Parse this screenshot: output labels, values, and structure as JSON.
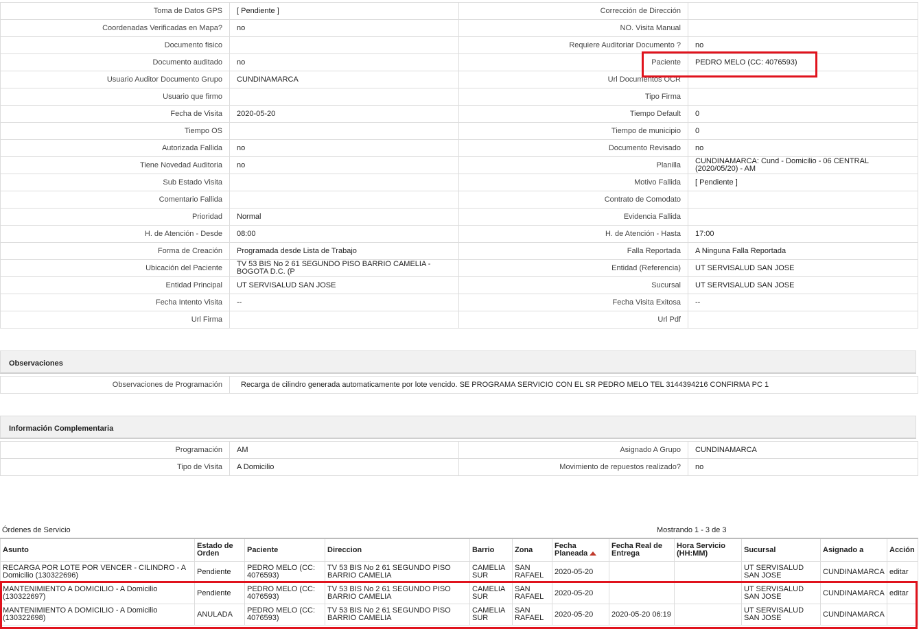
{
  "details": [
    [
      "Toma de Datos GPS",
      "[ Pendiente ]",
      "Corrección de Dirección",
      ""
    ],
    [
      "Coordenadas Verificadas en Mapa?",
      " no",
      "NO. Visita Manual",
      ""
    ],
    [
      "Documento fisico",
      "",
      "Requiere Auditoriar Documento ?",
      " no"
    ],
    [
      "Documento auditado",
      " no",
      "Paciente",
      "PEDRO MELO (CC: 4076593)"
    ],
    [
      "Usuario Auditor Documento Grupo",
      "CUNDINAMARCA",
      "Url Documentos OCR",
      ""
    ],
    [
      "Usuario que firmo",
      "",
      "Tipo Firma",
      ""
    ],
    [
      "Fecha de Visita",
      " 2020-05-20",
      "Tiempo Default",
      "0"
    ],
    [
      "Tiempo OS",
      "",
      "Tiempo de municipio",
      "0"
    ],
    [
      "Autorizada Fallida",
      " no",
      "Documento Revisado",
      " no"
    ],
    [
      "Tiene Novedad Auditoria",
      " no",
      "Planilla",
      "CUNDINAMARCA: Cund - Domicilio - 06 CENTRAL (2020/05/20) - AM"
    ],
    [
      "Sub Estado Visita",
      "",
      "Motivo Fallida",
      "[ Pendiente ]"
    ],
    [
      "Comentario Fallida",
      "",
      "Contrato de Comodato",
      ""
    ],
    [
      "Prioridad",
      "Normal",
      "Evidencia Fallida",
      ""
    ],
    [
      "H. de Atención - Desde",
      "08:00",
      "H. de Atención - Hasta",
      "17:00"
    ],
    [
      "Forma de Creación",
      "Programada desde Lista de Trabajo",
      "Falla Reportada",
      "A Ninguna Falla Reportada"
    ],
    [
      "Ubicación del Paciente",
      "TV 53 BIS No 2 61 SEGUNDO PISO BARRIO CAMELIA - BOGOTA D.C. (P",
      "Entidad (Referencia)",
      "UT SERVISALUD SAN JOSE"
    ],
    [
      "Entidad Principal",
      "UT SERVISALUD SAN JOSE",
      "Sucursal",
      "UT SERVISALUD SAN JOSE"
    ],
    [
      "Fecha Intento Visita",
      " --",
      "Fecha Visita Exitosa",
      " --"
    ],
    [
      "Url Firma",
      "",
      "Url Pdf",
      ""
    ]
  ],
  "observaciones": {
    "title": "Observaciones",
    "label": "Observaciones de Programación",
    "value": "Recarga de cilindro generada automaticamente por lote vencido. SE PROGRAMA SERVICIO CON EL SR PEDRO MELO TEL 3144394216 CONFIRMA PC 1"
  },
  "complementaria": {
    "title": "Información Complementaria",
    "rows": [
      [
        "Programación",
        "AM",
        "Asignado A Grupo",
        "CUNDINAMARCA"
      ],
      [
        "Tipo de Visita",
        "A Domicilio",
        "Movimiento de repuestos realizado?",
        " no"
      ]
    ]
  },
  "ordenes": {
    "title": "Órdenes de Servicio",
    "count": "Mostrando 1 - 3 de 3",
    "columns": [
      "Asunto",
      "Estado de Orden",
      "Paciente",
      "Direccion",
      "Barrio",
      "Zona",
      "Fecha Planeada",
      "Fecha Real de Entrega",
      "Hora Servicio (HH:MM)",
      "Sucursal",
      "Asignado a",
      "Acción"
    ],
    "rows": [
      [
        "RECARGA POR LOTE POR VENCER - CILINDRO - A Domicilio (130322696)",
        "Pendiente",
        "PEDRO MELO (CC: 4076593)",
        "TV 53 BIS No 2 61 SEGUNDO PISO BARRIO CAMELIA",
        "CAMELIA SUR",
        "SAN RAFAEL",
        "2020-05-20",
        "",
        "",
        "UT SERVISALUD SAN JOSE",
        "CUNDINAMARCA",
        "editar"
      ],
      [
        "MANTENIMIENTO A DOMICILIO - A Domicilio (130322697)",
        "Pendiente",
        "PEDRO MELO (CC: 4076593)",
        "TV 53 BIS No 2 61 SEGUNDO PISO BARRIO CAMELIA",
        "CAMELIA SUR",
        "SAN RAFAEL",
        "2020-05-20",
        "",
        "",
        "UT SERVISALUD SAN JOSE",
        "CUNDINAMARCA",
        "editar"
      ],
      [
        "MANTENIMIENTO A DOMICILIO - A Domicilio (130322698)",
        "ANULADA",
        "PEDRO MELO (CC: 4076593)",
        "TV 53 BIS No 2 61 SEGUNDO PISO BARRIO CAMELIA",
        "CAMELIA SUR",
        "SAN RAFAEL",
        "2020-05-20",
        "2020-05-20 06:19",
        "",
        "UT SERVISALUD SAN JOSE",
        "CUNDINAMARCA",
        ""
      ]
    ]
  },
  "colors": {
    "highlight": "#e0131d",
    "border": "#dcdcdc",
    "section_bg": "#f1f1f1",
    "sort_arrow": "#c0392b"
  }
}
